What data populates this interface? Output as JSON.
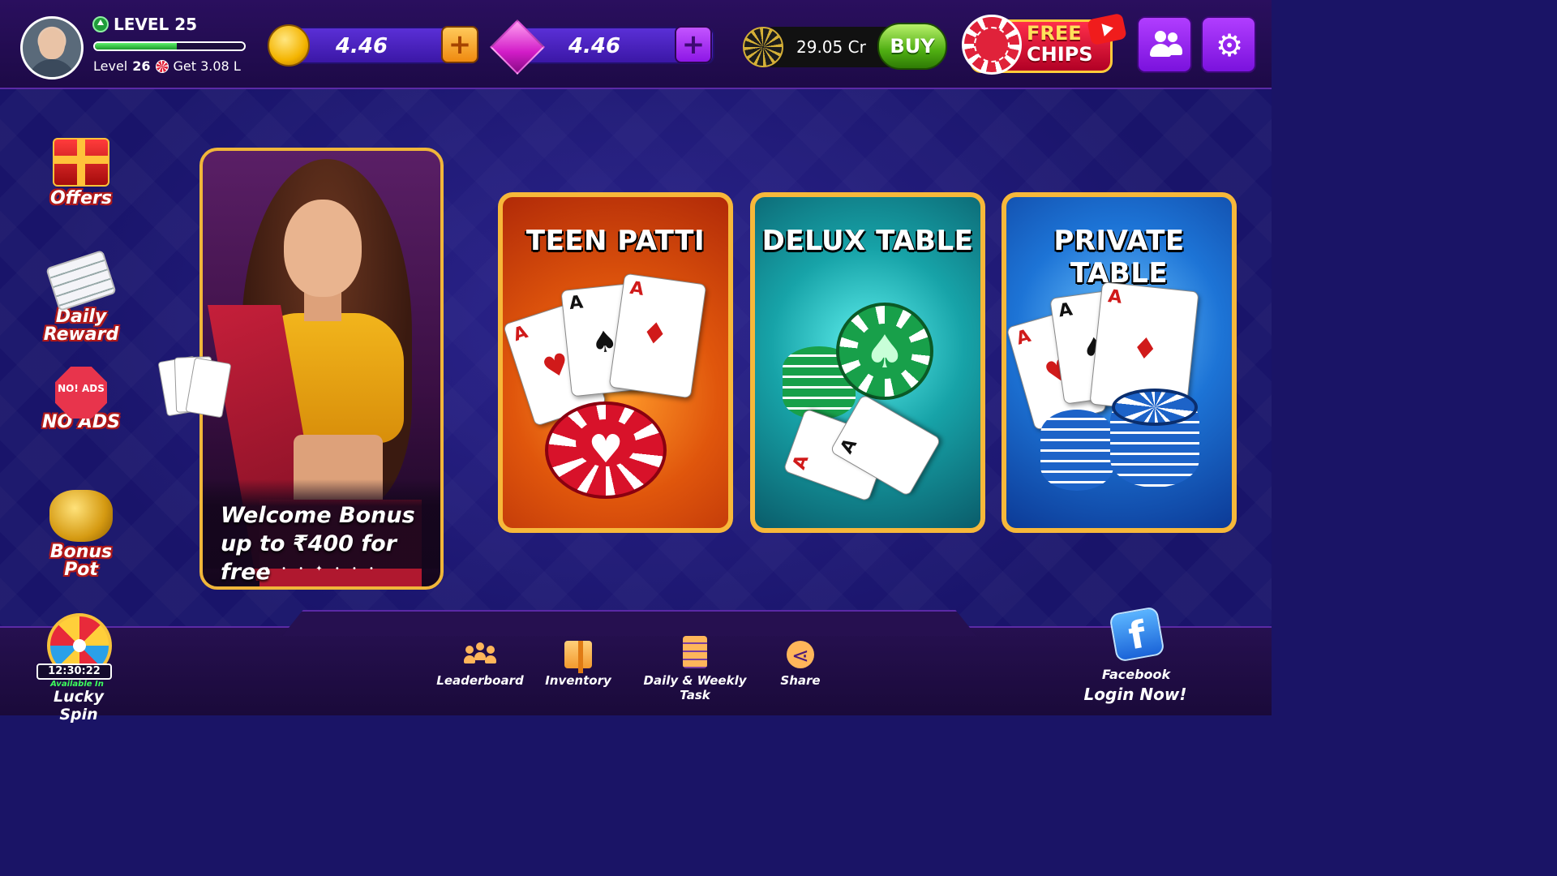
{
  "header": {
    "level_title": "LEVEL 25",
    "level_progress": 0.55,
    "next_level_prefix": "Level",
    "next_level_number": "26",
    "next_level_reward": "Get 3.08 L",
    "coins": "4.46",
    "gems": "4.46",
    "chips": "29.05 Cr",
    "buy_label": "BUY",
    "free_chips_line1": "FREE",
    "free_chips_line2": "CHIPS"
  },
  "sidebar": {
    "items": [
      {
        "label": "Offers"
      },
      {
        "label": "Daily Reward"
      },
      {
        "label": "NO ADS"
      },
      {
        "label": "Bonus Pot"
      }
    ],
    "no_ads_badge": "NO! ADS"
  },
  "promo": {
    "line1": "Welcome Bonus",
    "line2": "up to ₹400 for free",
    "dots": "• • • ✦ • • •"
  },
  "games": [
    {
      "title": "TEEN PATTI",
      "theme_color": "#e0560c"
    },
    {
      "title": "DELUX TABLE",
      "theme_color": "#17a3a8"
    },
    {
      "title": "PRIVATE TABLE",
      "theme_color": "#1d74d6"
    }
  ],
  "bottom_nav": {
    "items": [
      {
        "label": "Leaderboard",
        "icon": "leaderboard-icon"
      },
      {
        "label": "Inventory",
        "icon": "gift-box-icon"
      },
      {
        "label": "Daily & Weekly Task",
        "icon": "clipboard-icon"
      },
      {
        "label": "Share",
        "icon": "share-icon"
      }
    ]
  },
  "lucky_spin": {
    "timer": "12:30:22",
    "available_label": "Available In",
    "label": "Lucky Spin"
  },
  "facebook": {
    "label": "Facebook",
    "login_label": "Login Now!"
  }
}
